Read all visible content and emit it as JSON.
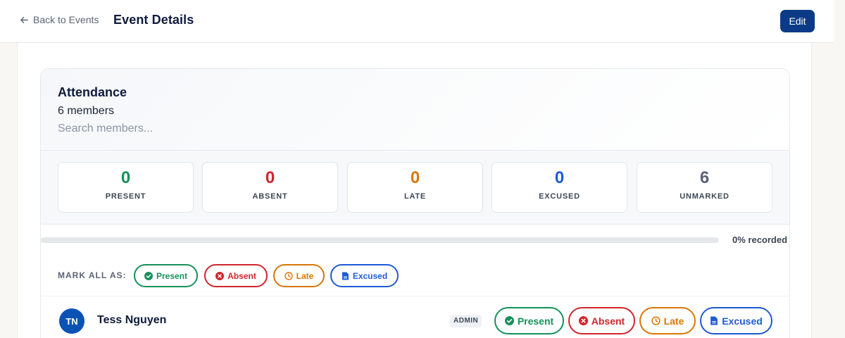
{
  "header": {
    "back_label": "Back to Events",
    "title": "Event Details",
    "edit_label": "Edit"
  },
  "attendance": {
    "title": "Attendance",
    "member_count": "6 members",
    "search_placeholder": "Search members...",
    "stats": [
      {
        "value": "0",
        "label": "PRESENT",
        "color": "#16915b"
      },
      {
        "value": "0",
        "label": "ABSENT",
        "color": "#d0262c"
      },
      {
        "value": "0",
        "label": "LATE",
        "color": "#d97706"
      },
      {
        "value": "0",
        "label": "EXCUSED",
        "color": "#1f5ad6"
      },
      {
        "value": "6",
        "label": "UNMARKED",
        "color": "#5b6474"
      }
    ],
    "progress": {
      "percent": 0,
      "label": "0% recorded"
    },
    "mark_all_label": "MARK ALL AS:",
    "statuses": [
      "Present",
      "Absent",
      "Late",
      "Excused"
    ]
  },
  "members": [
    {
      "initials": "TN",
      "name": "Tess Nguyen",
      "role": "ADMIN"
    }
  ],
  "icons": {
    "back": "arrow-left-icon",
    "present": "check-circle-icon",
    "absent": "x-circle-icon",
    "late": "clock-icon",
    "excused": "document-icon"
  },
  "colors": {
    "accent": "#0b3b86",
    "avatar": "#0b52b5"
  }
}
